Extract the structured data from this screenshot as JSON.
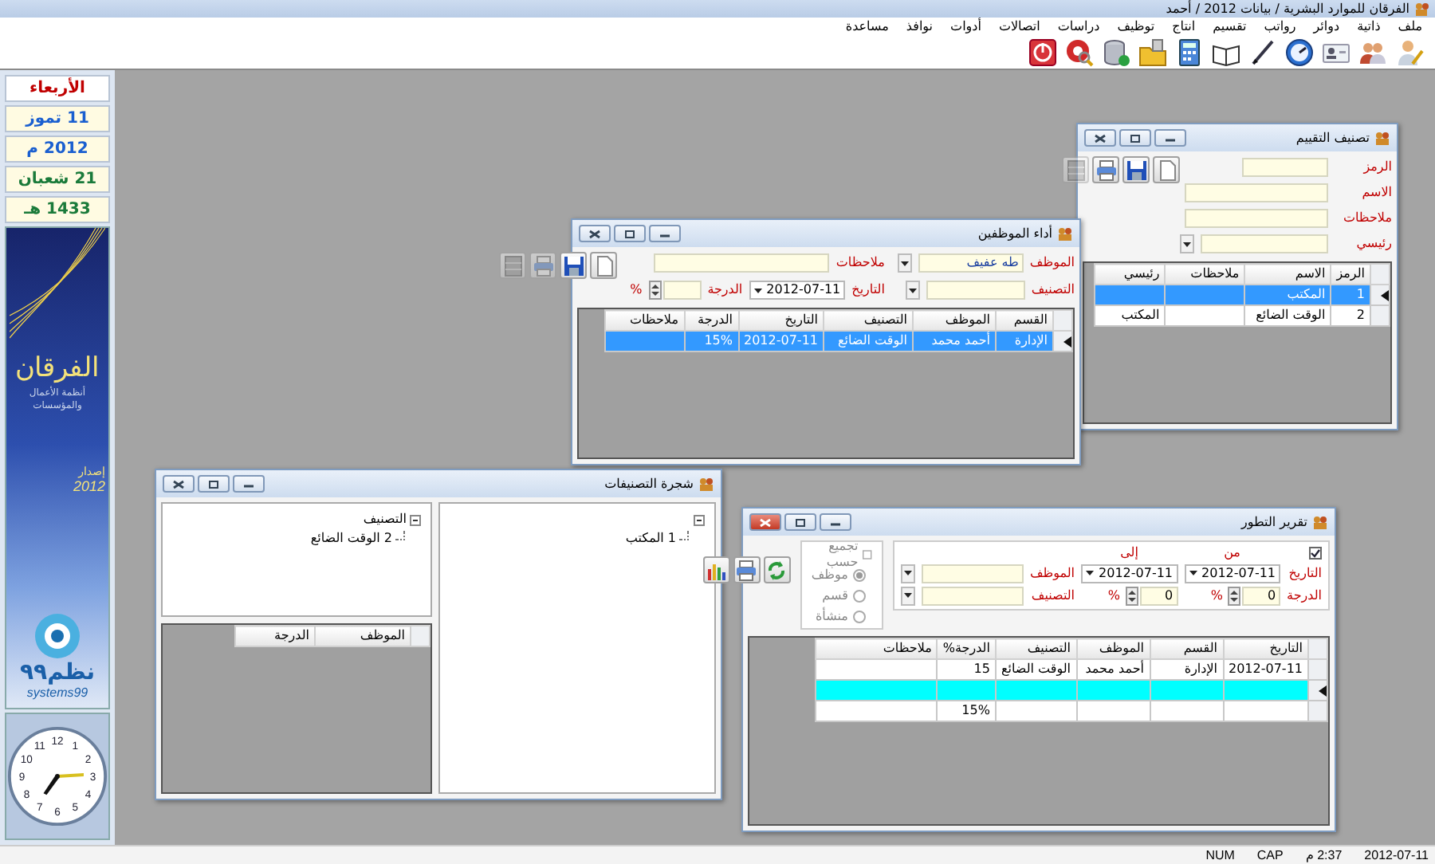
{
  "window": {
    "title": "الفرقان للموارد البشرية / بيانات 2012 / أحمد"
  },
  "menu": [
    "ملف",
    "ذاتية",
    "دوائر",
    "رواتب",
    "تقسيم",
    "انتاج",
    "توظيف",
    "دراسات",
    "اتصالات",
    "أدوات",
    "نوافذ",
    "مساعدة"
  ],
  "sidebar": {
    "dates": [
      {
        "kind": "weekday",
        "text": "الأربعاء",
        "color": "#c00000"
      },
      {
        "kind": "date",
        "text": "11 تموز",
        "color": "#1a5fd0"
      },
      {
        "kind": "date",
        "text": "2012 م",
        "color": "#1a5fd0"
      },
      {
        "kind": "date",
        "text": "21 شعبان",
        "color": "#1a7a3a"
      },
      {
        "kind": "date",
        "text": "1433 هـ",
        "color": "#1a7a3a"
      }
    ],
    "logo": {
      "title": "الفرقان",
      "subtitle": "أنظمة الأعمال والمؤسسات",
      "edition": "إصدار",
      "year": "2012",
      "brand": "نظم٩٩",
      "brand_latin": "systems99"
    },
    "clock": {
      "numerals": [
        "12",
        "1",
        "11",
        "2",
        "10",
        "3",
        "9",
        "4",
        "8",
        "5",
        "7",
        "6"
      ]
    }
  },
  "windows": [
    {
      "kind": "classification",
      "title": "تصنيف التقييم",
      "active": false,
      "fields": [
        {
          "kind": "text",
          "label": "الرمز"
        },
        {
          "kind": "text",
          "label": "الاسم"
        },
        {
          "kind": "text",
          "label": "ملاحظات"
        },
        {
          "kind": "dropdown",
          "label": "رئيسي"
        }
      ],
      "buttons": [
        {
          "kind": "new",
          "disabled": false
        },
        {
          "kind": "save",
          "disabled": false
        },
        {
          "kind": "print",
          "disabled": false
        },
        {
          "kind": "delete",
          "disabled": true
        }
      ],
      "table": {
        "columns": [
          "الرمز",
          "الاسم",
          "ملاحظات",
          "رئيسي"
        ],
        "rows": [
          {
            "selected": true,
            "cells": [
              "1",
              "المكتب",
              null,
              null
            ]
          },
          {
            "selected": false,
            "cells": [
              "2",
              "الوقت الضائع",
              null,
              "المكتب"
            ]
          }
        ]
      }
    },
    {
      "kind": "performance",
      "title": "أداء الموظفين",
      "active": false,
      "employee": {
        "label": "الموظف",
        "value": "طه عفيف"
      },
      "category": {
        "label": "التصنيف"
      },
      "notes": {
        "label": "ملاحظات"
      },
      "date": {
        "label": "التاريخ",
        "value": "2012-07-11"
      },
      "grade": {
        "label": "الدرجة",
        "unit": "%"
      },
      "buttons": [
        {
          "kind": "new",
          "disabled": false
        },
        {
          "kind": "save",
          "disabled": false
        },
        {
          "kind": "print",
          "disabled": true
        },
        {
          "kind": "delete",
          "disabled": true
        }
      ],
      "table": {
        "columns": [
          "القسم",
          "الموظف",
          "التصنيف",
          "التاريخ",
          "الدرجة",
          "ملاحظات"
        ],
        "rows": [
          {
            "selected": true,
            "cells": [
              "الإدارة",
              "أحمد محمد",
              "الوقت الضائع",
              "2012-07-11",
              "15%",
              null
            ]
          }
        ]
      }
    },
    {
      "kind": "tree",
      "title": "شجرة التصنيفات",
      "active": false,
      "main_tree": [
        {
          "expanded": true,
          "children": [
            {
              "label": "1 المكتب"
            }
          ]
        }
      ],
      "side_tree": [
        {
          "label": "التصنيف",
          "expanded": true,
          "children": [
            {
              "label": "2 الوقت الضائع"
            }
          ]
        }
      ],
      "table": {
        "columns": [
          "الموظف",
          "الدرجة"
        ]
      }
    },
    {
      "kind": "report",
      "title": "تقرير التطور",
      "active": true,
      "filter_enabled": true,
      "from_label": "من",
      "to_label": "إلى",
      "date": {
        "label": "التاريخ",
        "from": "2012-07-11",
        "to": "2012-07-11"
      },
      "grade": {
        "label": "الدرجة",
        "from": "0",
        "from_unit": "%",
        "to": "0",
        "to_unit": "%"
      },
      "employee": {
        "label": "الموظف"
      },
      "category": {
        "label": "التصنيف"
      },
      "grouping": {
        "label": "تجميع حسب",
        "checked": false,
        "disabled": true,
        "options": [
          {
            "label": "موظف",
            "selected": true
          },
          {
            "label": "قسم",
            "selected": false
          },
          {
            "label": "منشأة",
            "selected": false
          }
        ]
      },
      "buttons": [
        {
          "kind": "refresh"
        },
        {
          "kind": "print"
        },
        {
          "kind": "chart"
        }
      ],
      "table": {
        "columns": [
          "التاريخ",
          "القسم",
          "الموظف",
          "التصنيف",
          "الدرجة%",
          "ملاحظات"
        ],
        "rows": [
          {
            "selected": false,
            "cells": [
              "2012-07-11",
              "الإدارة",
              "أحمد محمد",
              "الوقت الضائع",
              "15",
              null
            ]
          },
          {
            "selected": true,
            "cells": [
              null,
              null,
              null,
              null,
              null,
              null
            ]
          },
          {
            "selected": false,
            "cells": [
              null,
              null,
              null,
              null,
              "15%",
              null
            ]
          }
        ]
      }
    }
  ],
  "status_bar": [
    "2012-07-11",
    "2:37 م",
    "CAP",
    "NUM"
  ]
}
